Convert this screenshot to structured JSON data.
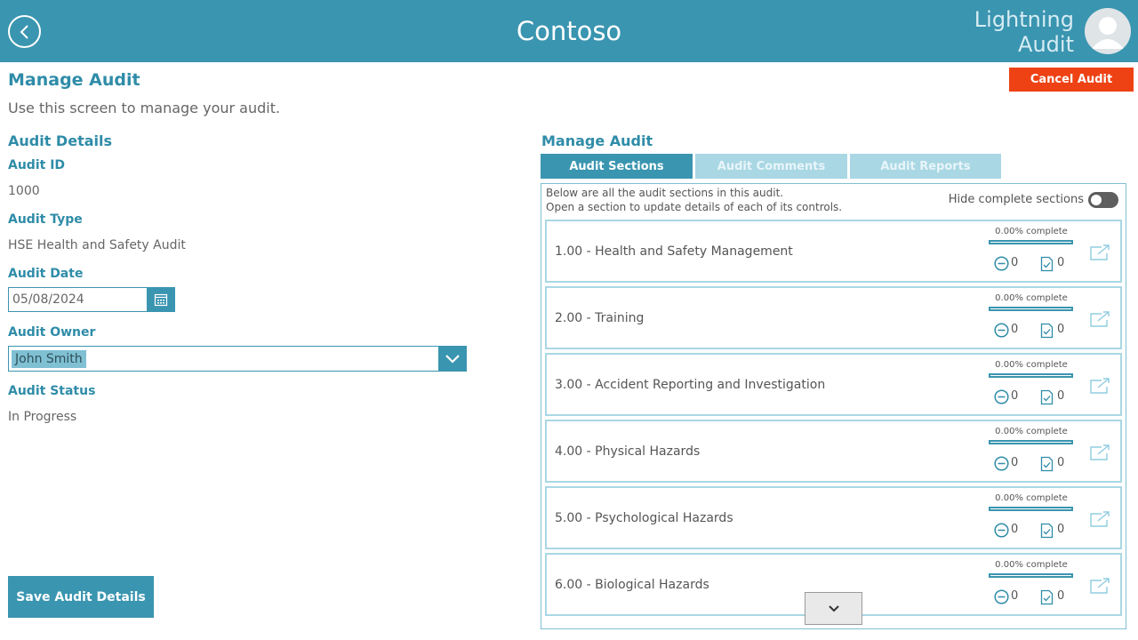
{
  "header": {
    "title": "Contoso",
    "brand_line1": "Lightning",
    "brand_line2": "Audit",
    "icons": {
      "back": "back-arrow-circle-icon",
      "avatar": "user-avatar-icon"
    }
  },
  "page": {
    "title": "Manage Audit",
    "subtitle": "Use this screen to manage your audit.",
    "cancel_label": "Cancel Audit"
  },
  "details": {
    "heading": "Audit Details",
    "audit_id_label": "Audit ID",
    "audit_id": "1000",
    "audit_type_label": "Audit Type",
    "audit_type": "HSE Health and Safety Audit",
    "audit_date_label": "Audit Date",
    "audit_date": "05/08/2024",
    "audit_owner_label": "Audit Owner",
    "audit_owner": "John Smith",
    "audit_status_label": "Audit Status",
    "audit_status": "In Progress",
    "save_label": "Save Audit Details"
  },
  "manage": {
    "heading": "Manage Audit",
    "tabs": [
      {
        "label": "Audit Sections",
        "active": true
      },
      {
        "label": "Audit Comments",
        "active": false
      },
      {
        "label": "Audit Reports",
        "active": false
      }
    ],
    "intro_line1": "Below are all the audit sections in this audit.",
    "intro_line2": "Open a section to update details of each of its controls.",
    "hide_label": "Hide complete sections",
    "hide_on": false
  },
  "sections": [
    {
      "label": "1.00 - Health and Safety Management",
      "pct_text": "0.00% complete",
      "progress": 0,
      "na": "0",
      "done": "0"
    },
    {
      "label": "2.00 - Training",
      "pct_text": "0.00% complete",
      "progress": 0,
      "na": "0",
      "done": "0"
    },
    {
      "label": "3.00 - Accident Reporting and Investigation",
      "pct_text": "0.00% complete",
      "progress": 0,
      "na": "0",
      "done": "0"
    },
    {
      "label": "4.00 - Physical Hazards",
      "pct_text": "0.00% complete",
      "progress": 0,
      "na": "0",
      "done": "0"
    },
    {
      "label": "5.00 - Psychological Hazards",
      "pct_text": "0.00% complete",
      "progress": 0,
      "na": "0",
      "done": "0"
    },
    {
      "label": "6.00 - Biological Hazards",
      "pct_text": "0.00% complete",
      "progress": 0,
      "na": "0",
      "done": "0"
    }
  ],
  "colors": {
    "primary": "#3a95b0",
    "tab_inactive": "#a9d7e4",
    "danger": "#ee4215"
  }
}
